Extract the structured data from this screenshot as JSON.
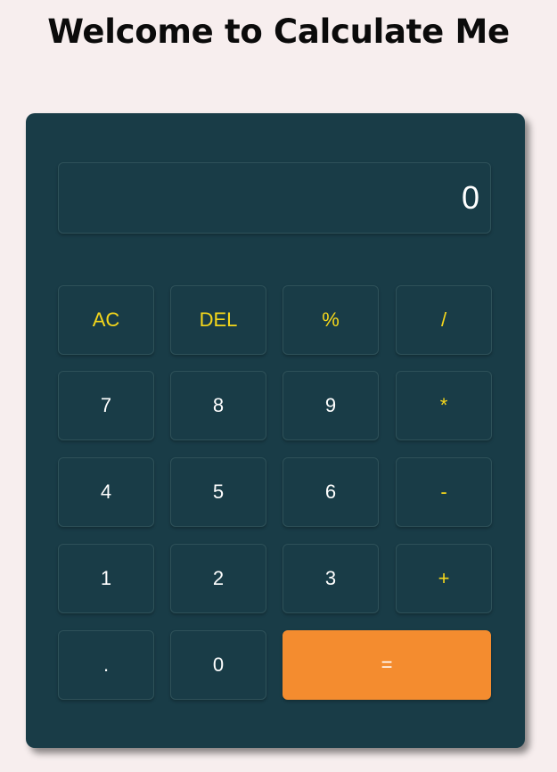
{
  "page": {
    "title": "Welcome to Calculate Me"
  },
  "display": {
    "value": "0"
  },
  "keys": {
    "ac": "AC",
    "del": "DEL",
    "percent": "%",
    "divide": "/",
    "seven": "7",
    "eight": "8",
    "nine": "9",
    "multiply": "*",
    "four": "4",
    "five": "5",
    "six": "6",
    "subtract": "-",
    "one": "1",
    "two": "2",
    "three": "3",
    "add": "+",
    "decimal": ".",
    "zero": "0",
    "equals": "="
  },
  "colors": {
    "page_background": "#f7eeee",
    "calculator_body": "#193c47",
    "operator_text": "#f5d71b",
    "digit_text": "#ffffff",
    "equals_background": "#f48c2f"
  }
}
